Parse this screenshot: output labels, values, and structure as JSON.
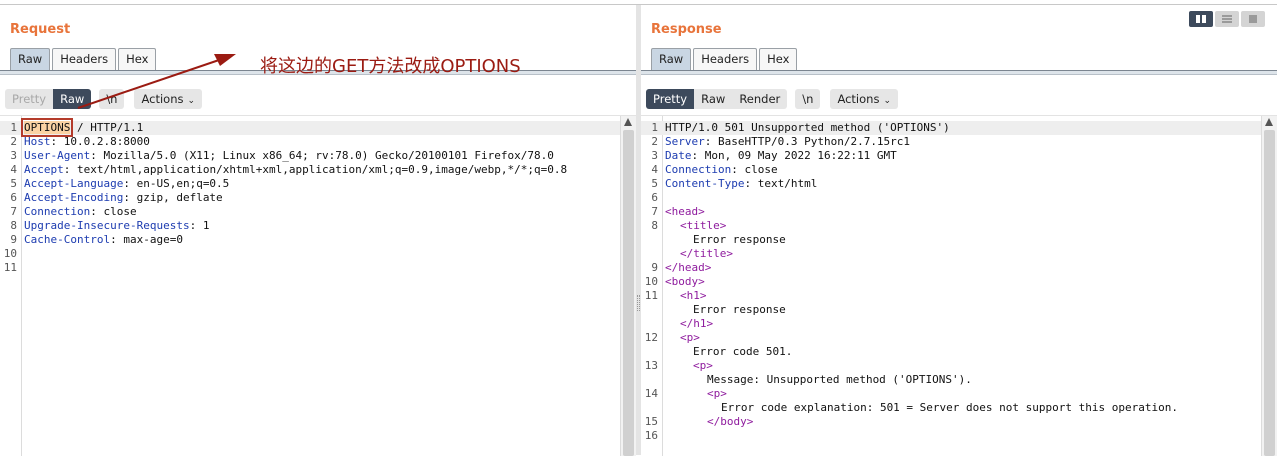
{
  "request": {
    "title": "Request",
    "tabs": [
      "Raw",
      "Headers",
      "Hex"
    ],
    "toolbar": {
      "pretty": "Pretty",
      "raw": "Raw",
      "newline": "\\n",
      "actions": "Actions"
    },
    "lines": [
      {
        "n": "1",
        "method": "OPTIONS",
        "rest": " / HTTP/1.1"
      },
      {
        "n": "2",
        "name": "Host",
        "value": ": 10.0.2.8:8000"
      },
      {
        "n": "3",
        "name": "User-Agent",
        "value": ": Mozilla/5.0 (X11; Linux x86_64; rv:78.0) Gecko/20100101 Firefox/78.0"
      },
      {
        "n": "4",
        "name": "Accept",
        "value": ": text/html,application/xhtml+xml,application/xml;q=0.9,image/webp,*/*;q=0.8"
      },
      {
        "n": "5",
        "name": "Accept-Language",
        "value": ": en-US,en;q=0.5"
      },
      {
        "n": "6",
        "name": "Accept-Encoding",
        "value": ": gzip, deflate"
      },
      {
        "n": "7",
        "name": "Connection",
        "value": ": close"
      },
      {
        "n": "8",
        "name": "Upgrade-Insecure-Requests",
        "value": ": 1"
      },
      {
        "n": "9",
        "name": "Cache-Control",
        "value": ": max-age=0"
      },
      {
        "n": "10"
      },
      {
        "n": "11"
      }
    ]
  },
  "response": {
    "title": "Response",
    "tabs": [
      "Raw",
      "Headers",
      "Hex"
    ],
    "toolbar": {
      "pretty": "Pretty",
      "raw": "Raw",
      "render": "Render",
      "newline": "\\n",
      "actions": "Actions"
    },
    "status_line": "HTTP/1.0 501 Unsupported method ('OPTIONS')",
    "headers": [
      {
        "n": "2",
        "name": "Server",
        "value": ": BaseHTTP/0.3 Python/2.7.15rc1"
      },
      {
        "n": "3",
        "name": "Date",
        "value": ": Mon, 09 May 2022 16:22:11 GMT"
      },
      {
        "n": "4",
        "name": "Connection",
        "value": ": close"
      },
      {
        "n": "5",
        "name": "Content-Type",
        "value": ": text/html"
      }
    ],
    "body": {
      "head_open": "<head>",
      "title_open": "<title>",
      "title_text": "Error response",
      "title_close": "</title>",
      "head_close": "</head>",
      "body_open": "<body>",
      "h1_open": "<h1>",
      "h1_text": "Error response",
      "h1_close": "</h1>",
      "p_open": "<p>",
      "code_text": "Error code 501.",
      "message_text": "Message: Unsupported method ('OPTIONS').",
      "explanation_text": "Error code explanation: 501 = Server does not support this operation.",
      "body_close": "</body>"
    }
  },
  "annotation": {
    "text": "将这边的GET方法改成OPTIONS",
    "color": "#9b1b12"
  },
  "colors": {
    "title": "#e8743b",
    "header_name": "#1d3cb0",
    "tag": "#8f1c9e",
    "active_button": "#3d4a5c"
  }
}
